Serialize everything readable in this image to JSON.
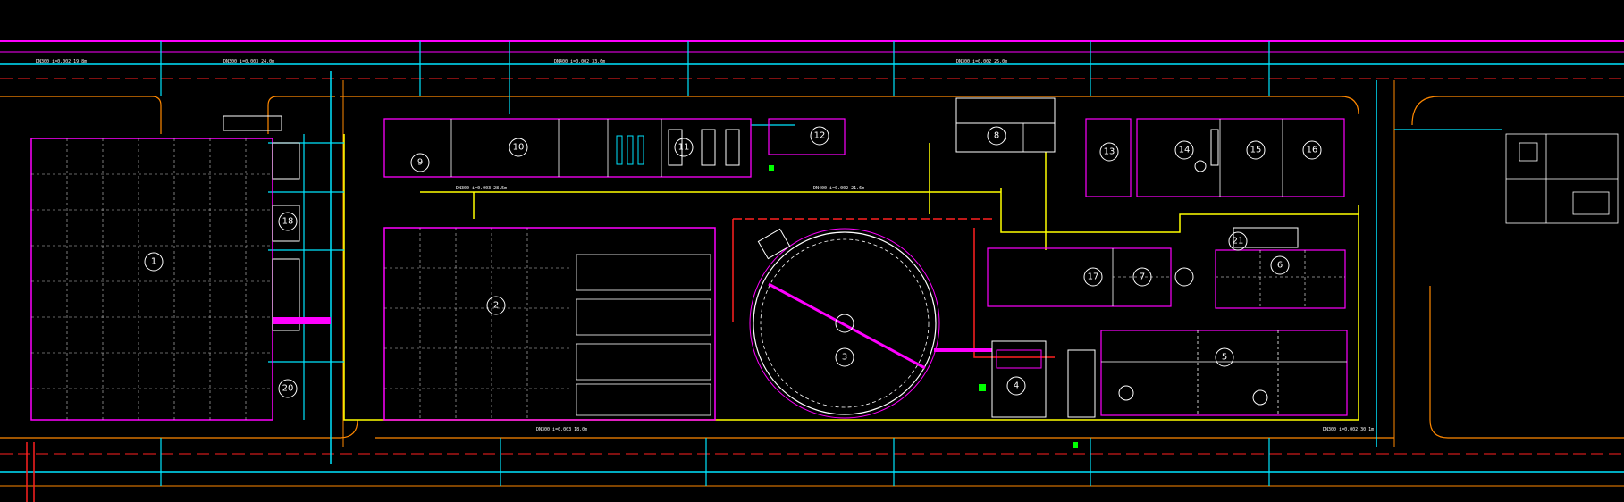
{
  "drawing": {
    "background": "#000000",
    "colors": {
      "pipe_main": "#ffff00",
      "pipe_branch": "#00e5ff",
      "building": "#ff00ff",
      "road": "#ff8800",
      "grid": "#ffffff",
      "red": "#ff2020",
      "green": "#00ff00"
    }
  },
  "units": [
    {
      "id": "1",
      "label": "1"
    },
    {
      "id": "2",
      "label": "2"
    },
    {
      "id": "3",
      "label": "3"
    },
    {
      "id": "4",
      "label": "4"
    },
    {
      "id": "5",
      "label": "5"
    },
    {
      "id": "6",
      "label": "6"
    },
    {
      "id": "7",
      "label": "7"
    },
    {
      "id": "8",
      "label": "8"
    },
    {
      "id": "9",
      "label": "9"
    },
    {
      "id": "10",
      "label": "10"
    },
    {
      "id": "11",
      "label": "11"
    },
    {
      "id": "12",
      "label": "12"
    },
    {
      "id": "13",
      "label": "13"
    },
    {
      "id": "14",
      "label": "14"
    },
    {
      "id": "15",
      "label": "15"
    },
    {
      "id": "16",
      "label": "16"
    },
    {
      "id": "17",
      "label": "17"
    },
    {
      "id": "18",
      "label": "18"
    },
    {
      "id": "20",
      "label": "20"
    },
    {
      "id": "21",
      "label": "21"
    }
  ],
  "annotations": [
    "DN300 i=0.002 19.8m",
    "DN300 i=0.003 24.0m",
    "DN400 i=0.002 33.6m",
    "DN300 i=0.002 25.0m",
    "DN300 i=0.003 18.0m",
    "DN300 i=0.002 30.1m",
    "DN300 i=0.003 28.5m",
    "DN400 i=0.002 21.6m"
  ]
}
